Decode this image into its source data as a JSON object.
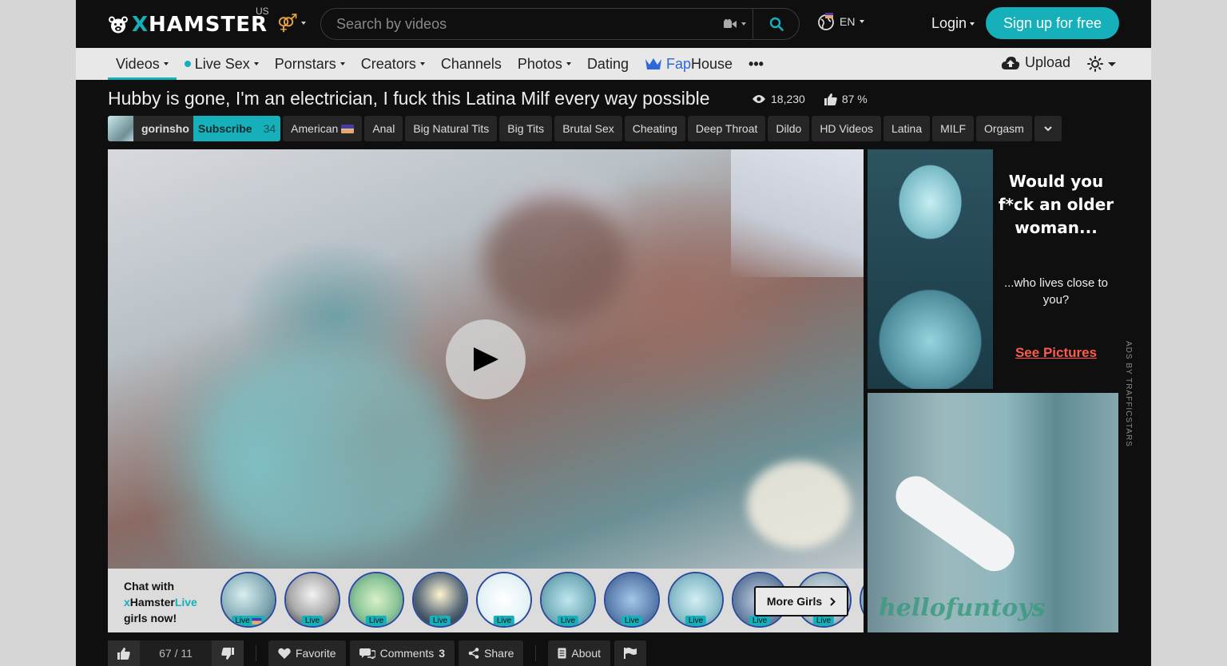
{
  "header": {
    "logo_text_x": "X",
    "logo_text_rest": "HAMSTER",
    "region": "US",
    "search_placeholder": "Search by videos",
    "language": "EN",
    "login": "Login",
    "signup": "Sign up for free"
  },
  "nav": {
    "items": [
      {
        "label": "Videos"
      },
      {
        "label": "Live Sex"
      },
      {
        "label": "Pornstars"
      },
      {
        "label": "Creators"
      },
      {
        "label": "Channels"
      },
      {
        "label": "Photos"
      },
      {
        "label": "Dating"
      }
    ],
    "faphouse_fap": "Fap",
    "faphouse_house": "House",
    "more": "•••",
    "upload": "Upload"
  },
  "video": {
    "title": "Hubby is gone, I'm an electrician, I fuck this Latina Milf every way possible",
    "views": "18,230",
    "rating_percent": "87 %"
  },
  "author": {
    "name": "gorinsho",
    "subscribe": "Subscribe",
    "subscribers": "34"
  },
  "tags": [
    "American",
    "Anal",
    "Big Natural Tits",
    "Big Tits",
    "Brutal Sex",
    "Cheating",
    "Deep Throat",
    "Dildo",
    "HD Videos",
    "Latina",
    "MILF",
    "Orgasm"
  ],
  "live": {
    "line1": "Chat with",
    "brand_x": "x",
    "brand_hamster": "Hamster",
    "brand_live": "Live",
    "line3": "girls now!",
    "badge": "Live",
    "more_girls": "More Girls"
  },
  "ads": {
    "headline": "Would you f*ck an older woman...",
    "sub": "...who lives close to you?",
    "cta": "See Pictures",
    "brand2": "hellofuntoys",
    "ads_by": "ADS BY TRAFFICSTARS"
  },
  "actions": {
    "votes": "67 / 11",
    "favorite": "Favorite",
    "comments": "Comments",
    "comments_count": "3",
    "share": "Share",
    "about": "About"
  },
  "colors": {
    "accent": "#16b0ba",
    "background": "#0f0f0f",
    "navbar": "#e8e8e8"
  }
}
